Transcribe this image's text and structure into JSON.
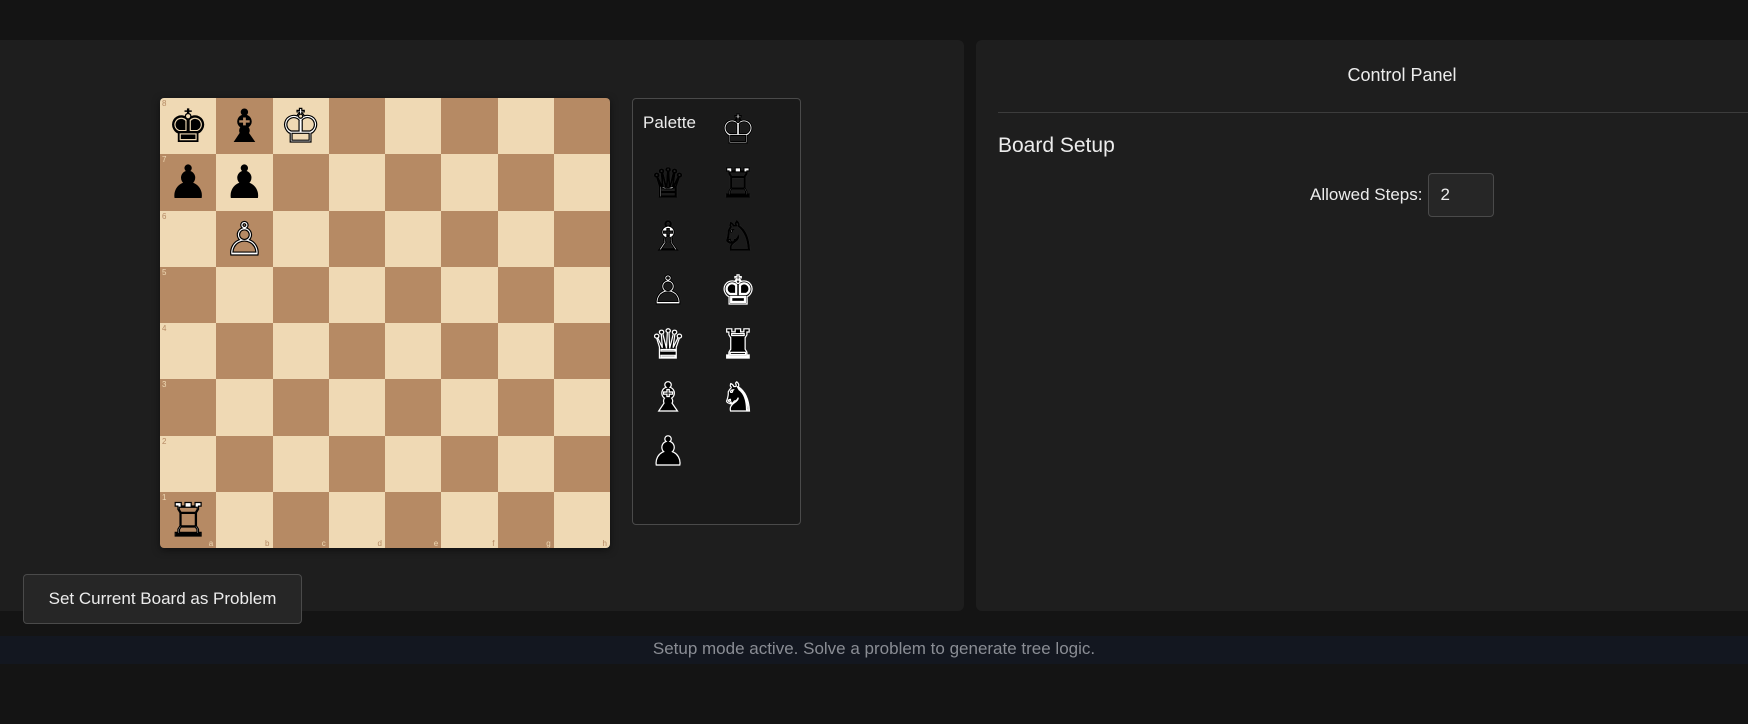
{
  "board": {
    "ranks": [
      "8",
      "7",
      "6",
      "5",
      "4",
      "3",
      "2",
      "1"
    ],
    "files": [
      "a",
      "b",
      "c",
      "d",
      "e",
      "f",
      "g",
      "h"
    ],
    "pieces": {
      "a8": {
        "glyph": "♚",
        "color": "black",
        "name": "black-king"
      },
      "b8": {
        "glyph": "♝",
        "color": "black",
        "name": "black-bishop"
      },
      "c8": {
        "glyph": "♔",
        "color": "white",
        "name": "white-king"
      },
      "a7": {
        "glyph": "♟",
        "color": "black",
        "name": "black-pawn"
      },
      "b7": {
        "glyph": "♟",
        "color": "black",
        "name": "black-pawn"
      },
      "b6": {
        "glyph": "♙",
        "color": "white",
        "name": "white-pawn"
      },
      "a1": {
        "glyph": "♖",
        "color": "white",
        "name": "white-rook"
      }
    }
  },
  "palette": {
    "title": "Palette",
    "items": [
      {
        "glyph": "♔",
        "color": "white",
        "name": "white-king"
      },
      {
        "glyph": "♕",
        "color": "white",
        "name": "white-queen"
      },
      {
        "glyph": "♖",
        "color": "white",
        "name": "white-rook"
      },
      {
        "glyph": "♗",
        "color": "white",
        "name": "white-bishop"
      },
      {
        "glyph": "♘",
        "color": "white",
        "name": "white-knight"
      },
      {
        "glyph": "♙",
        "color": "white",
        "name": "white-pawn"
      },
      {
        "glyph": "♚",
        "color": "black",
        "name": "black-king"
      },
      {
        "glyph": "♛",
        "color": "black",
        "name": "black-queen"
      },
      {
        "glyph": "♜",
        "color": "black",
        "name": "black-rook"
      },
      {
        "glyph": "♝",
        "color": "black",
        "name": "black-bishop"
      },
      {
        "glyph": "♞",
        "color": "black",
        "name": "black-knight"
      },
      {
        "glyph": "♟",
        "color": "black",
        "name": "black-pawn"
      }
    ]
  },
  "actions": {
    "set_problem_label": "Set Current Board as Problem"
  },
  "control_panel": {
    "title": "Control Panel",
    "section_title": "Board Setup",
    "allowed_steps_label": "Allowed Steps:",
    "allowed_steps_value": "2"
  },
  "status": {
    "message": "Setup mode active. Solve a problem to generate tree logic."
  },
  "colors": {
    "light_square": "#efd9b4",
    "dark_square": "#b68a64",
    "background": "#141414",
    "panel": "#1e1e1e"
  }
}
